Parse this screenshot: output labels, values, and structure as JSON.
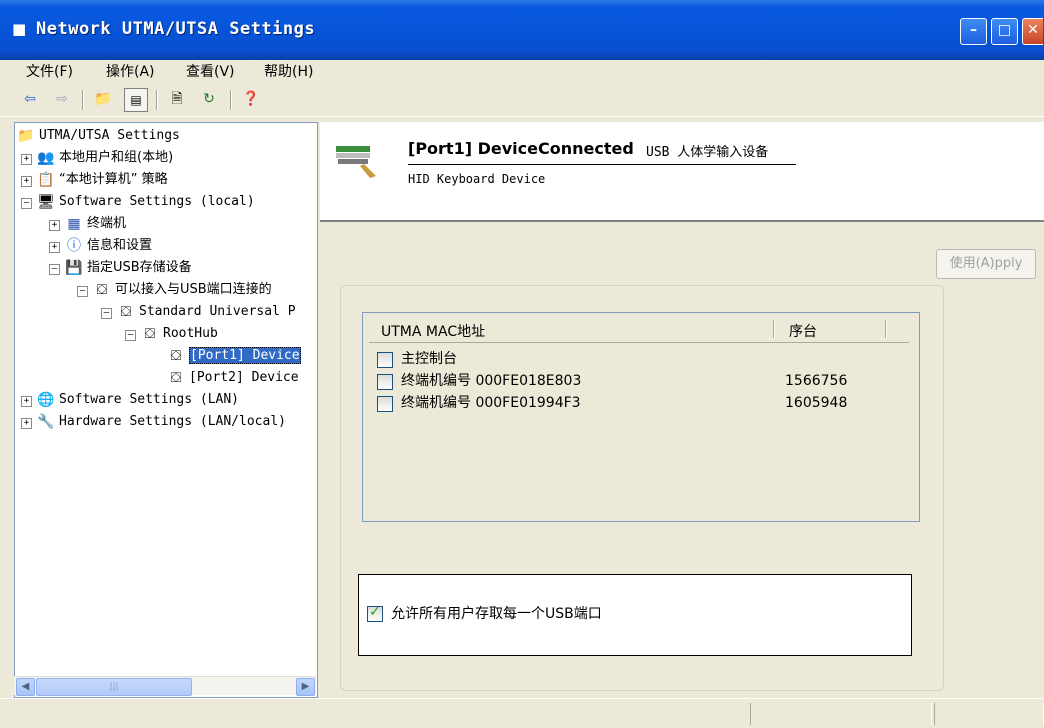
{
  "window": {
    "title": "Network UTMA/UTSA Settings",
    "buttons": [
      "minimize",
      "maximize",
      "close"
    ]
  },
  "menu": [
    "文件(F)",
    "操作(A)",
    "查看(V)",
    "帮助(H)"
  ],
  "toolbar": [
    "back-arrow-icon",
    "forward-arrow-icon",
    "up-folder-icon",
    "show-tree-icon",
    "properties-icon",
    "refresh-icon",
    "help-icon"
  ],
  "tree": {
    "root": "UTMA/UTSA Settings",
    "local_users": "本地用户和组(本地)",
    "local_policy": "“本地计算机” 策略",
    "software_local": "Software Settings (local)",
    "terminal": "终端机",
    "info": "信息和设置",
    "usb_storage": "指定USB存储设备",
    "usb_connect": "可以接入与USB端口连接的",
    "standard_universal": "Standard Universal P",
    "roothub": "RootHub",
    "port1": "[Port1] Device",
    "port2": "[Port2] Device",
    "software_lan": "Software Settings (LAN)",
    "hardware_lan": "Hardware Settings (LAN/local)"
  },
  "detail": {
    "device_title": "[Port1] DeviceConnected",
    "device_desc": "USB 人体学输入设备",
    "device_name": "HID Keyboard Device",
    "apply_label": "使用(A)pply",
    "columns": [
      "UTMA MAC地址",
      "序台"
    ],
    "rows": [
      {
        "label": "主控制台",
        "serial": "",
        "checked": false
      },
      {
        "label": "终端机编号  000FE018E803",
        "serial": "1566756",
        "checked": false
      },
      {
        "label": "终端机编号  000FE01994F3",
        "serial": "1605948",
        "checked": false
      }
    ],
    "allow_label": "允许所有用户存取每一个USB端口",
    "allow_checked": true
  }
}
